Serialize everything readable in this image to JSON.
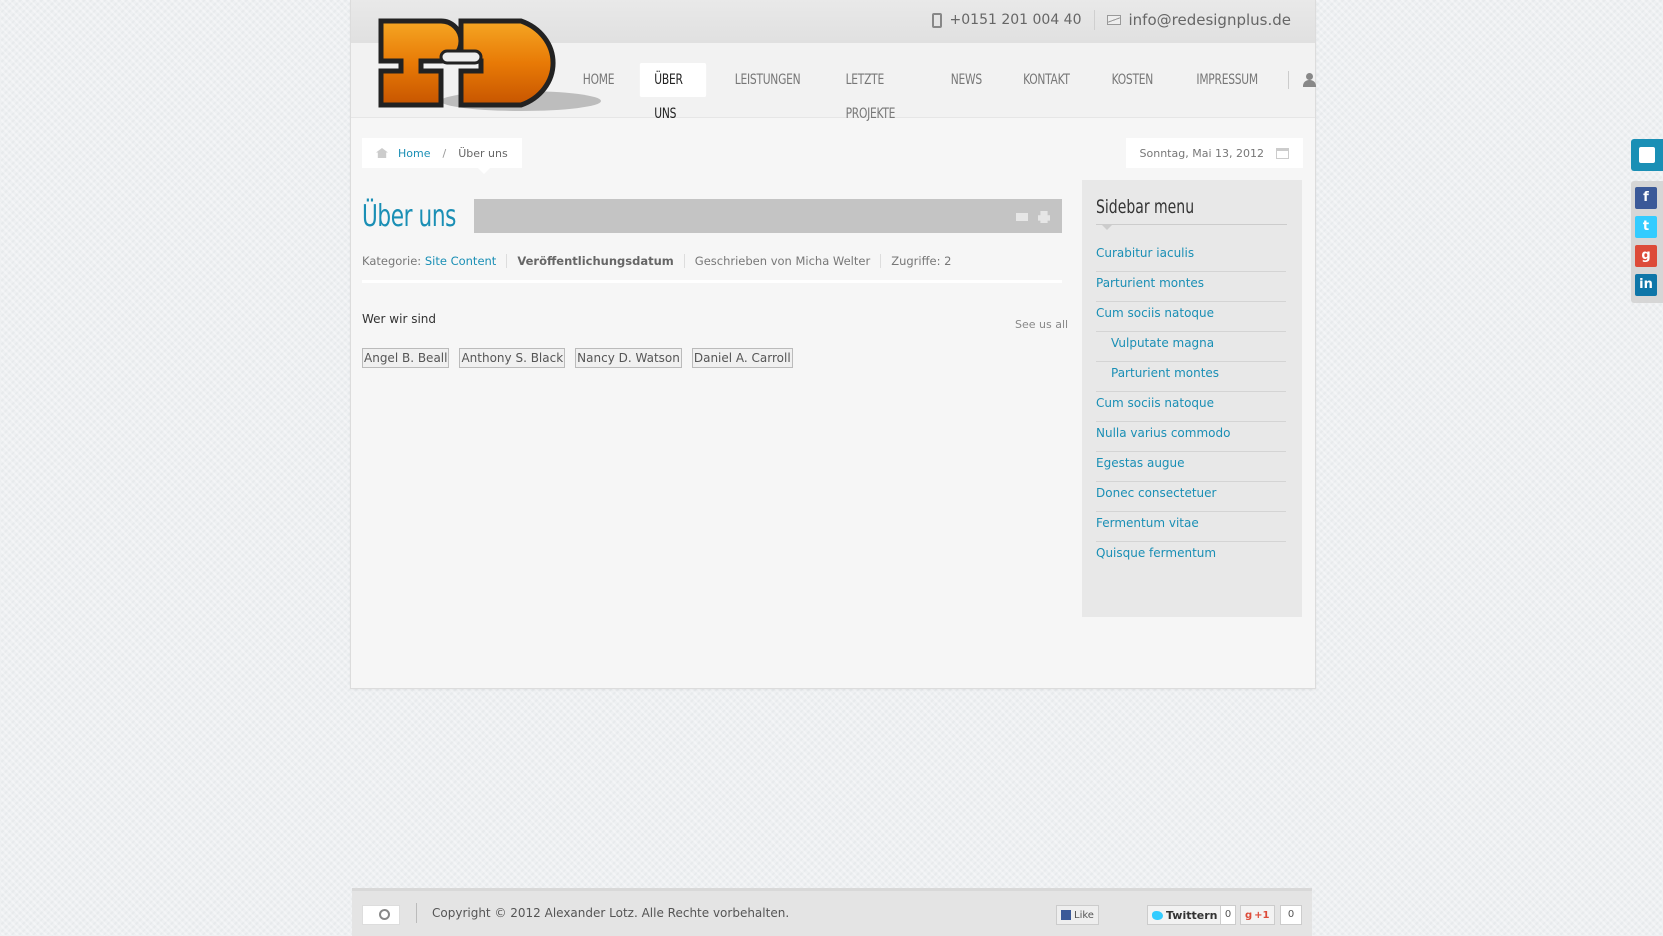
{
  "contact": {
    "phone": "+0151 201 004 40",
    "email": "info@redesignplus.de"
  },
  "nav": {
    "items": [
      "HOME",
      "ÜBER UNS",
      "LEISTUNGEN",
      "LETZTE PROJEKTE",
      "NEWS",
      "KONTAKT",
      "KOSTEN",
      "IMPRESSUM"
    ],
    "active_index": 1
  },
  "breadcrumb": {
    "home": "Home",
    "separator": "/",
    "current": "Über uns"
  },
  "date": "Sonntag, Mai 13, 2012",
  "article": {
    "title": "Über uns",
    "meta": {
      "category_label": "Kategorie:",
      "category_value": "Site Content",
      "published": "Veröffentlichungsdatum",
      "author": "Geschrieben von Micha Welter",
      "hits": "Zugriffe: 2"
    },
    "section_label": "Wer wir sind",
    "see_all": "See us all",
    "people": [
      "Angel B. Beall",
      "Anthony S. Black",
      "Nancy D. Watson",
      "Daniel A. Carroll"
    ]
  },
  "sidebar": {
    "title": "Sidebar menu",
    "items": [
      {
        "label": "Curabitur iaculis",
        "sub": false
      },
      {
        "label": "Parturient montes",
        "sub": false
      },
      {
        "label": "Cum sociis natoque",
        "sub": false
      },
      {
        "label": "Vulputate magna",
        "sub": true
      },
      {
        "label": "Parturient montes",
        "sub": true
      },
      {
        "label": "Cum sociis natoque",
        "sub": false
      },
      {
        "label": "Nulla varius commodo",
        "sub": false
      },
      {
        "label": "Egestas augue",
        "sub": false
      },
      {
        "label": "Donec consectetuer",
        "sub": false
      },
      {
        "label": "Fermentum vitae",
        "sub": false
      },
      {
        "label": "Quisque fermentum",
        "sub": false
      }
    ]
  },
  "footer": {
    "copyright": "Copyright © 2012 Alexander Lotz. Alle Rechte vorbehalten.",
    "fb_like": "Like",
    "twitter": "Twittern",
    "twitter_count": "0",
    "gplus": "+1",
    "gplus_count": "0"
  },
  "social": {
    "icons": [
      "facebook-icon",
      "twitter-icon",
      "google-plus-icon",
      "linkedin-icon"
    ],
    "colors": [
      "#3b5998",
      "#33ccff",
      "#dd4b39",
      "#0e76a8"
    ]
  },
  "colors": {
    "accent": "#1a8fb5"
  }
}
